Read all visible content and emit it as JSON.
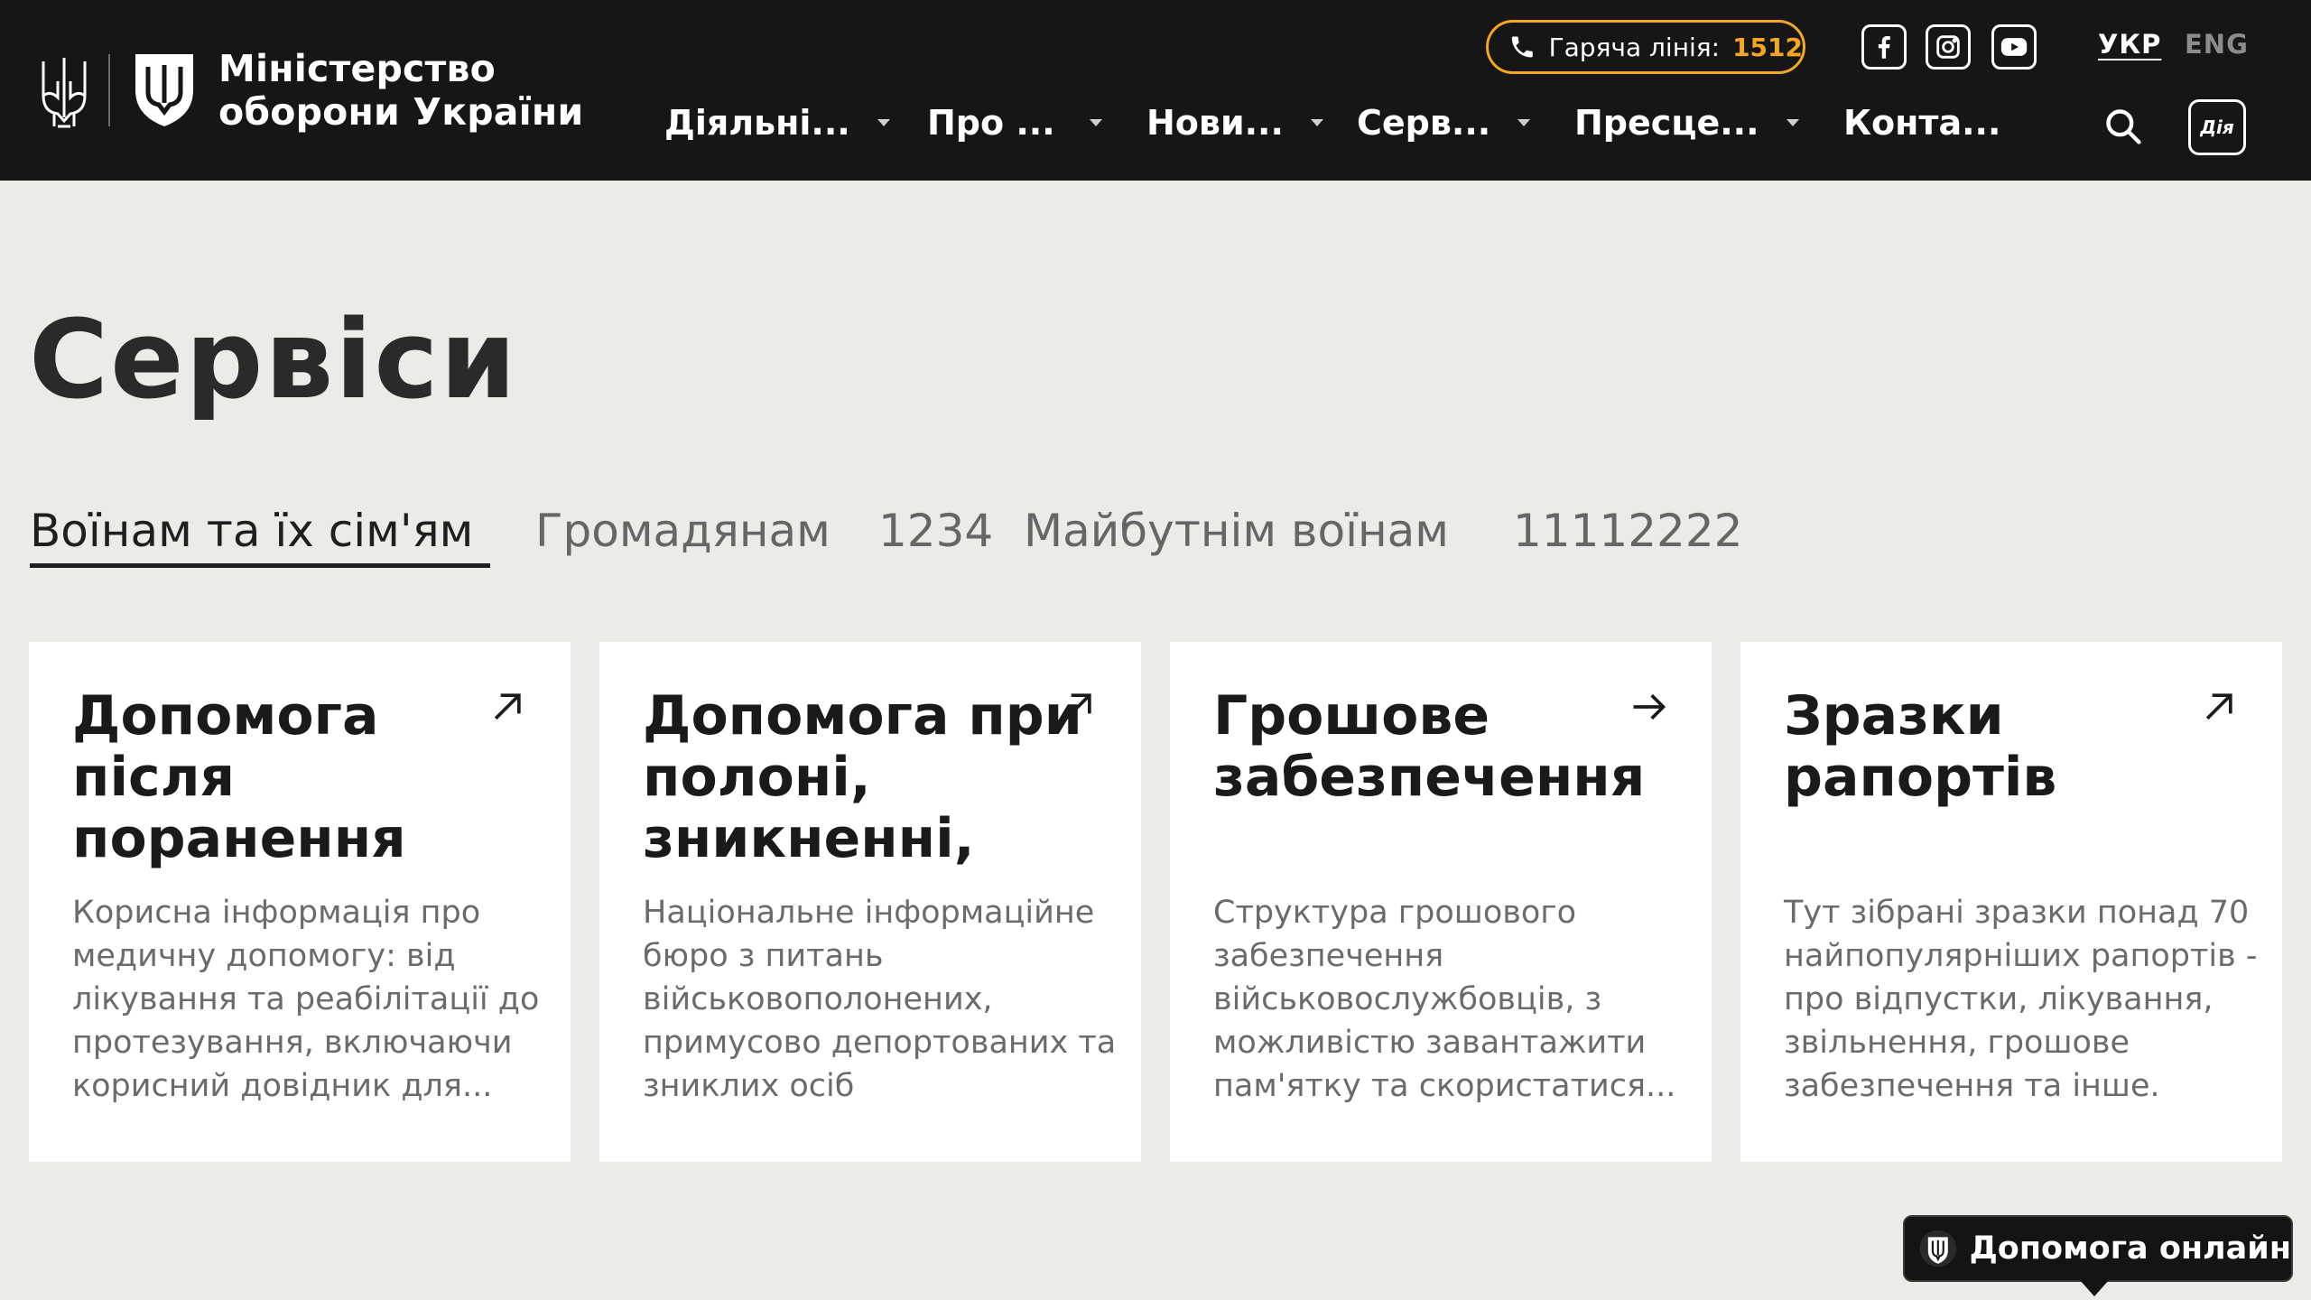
{
  "brand": {
    "line1": "Міністерство",
    "line2": "оборони України"
  },
  "hotline": {
    "label": "Гаряча лінія:",
    "number": "1512"
  },
  "social": {
    "facebook": "facebook-icon",
    "instagram": "instagram-icon",
    "youtube": "youtube-icon"
  },
  "languages": {
    "ukr": "УКР",
    "eng": "ENG"
  },
  "nav": {
    "items": [
      {
        "label": "Діяльні..."
      },
      {
        "label": "Про ..."
      },
      {
        "label": "Нови..."
      },
      {
        "label": "Серв..."
      },
      {
        "label": "Пресце..."
      },
      {
        "label": "Конта..."
      }
    ]
  },
  "diia": {
    "label": "Дія"
  },
  "page": {
    "title": "Сервіси"
  },
  "tabs": [
    {
      "label": "Воїнам та їх сім'ям",
      "active": true
    },
    {
      "label": "Громадянам",
      "active": false
    },
    {
      "label": "1234",
      "active": false
    },
    {
      "label": "Майбутнім воїнам",
      "active": false
    },
    {
      "label": "11112222",
      "active": false
    }
  ],
  "cards": [
    {
      "title": "Допомога після поранення",
      "description": "Корисна інформація про медичну допомогу: від лікування та реабілітації до протезування, включаючи корисний довідник для...",
      "arrow": "arrow-up-right-icon"
    },
    {
      "title": "Допомога при полоні, зникненні,",
      "description": "Національне інформаційне бюро з питань військовополонених, примусово депортованих та зниклих осіб",
      "arrow": "arrow-up-right-icon"
    },
    {
      "title": "Грошове забезпечення",
      "description": "Структура грошового забезпечення військовослужбовців, з можливістю завантажити пам'ятку та скористатися...",
      "arrow": "arrow-right-icon"
    },
    {
      "title": "Зразки рапортів",
      "description": "Тут зібрані зразки понад 70 найпопулярніших рапортів - про відпустки, лікування, звільнення, грошове забезпечення та інше.",
      "arrow": "arrow-up-right-icon"
    }
  ],
  "help": {
    "label": "Допомога онлайн"
  },
  "colors": {
    "header_bg": "#161616",
    "page_bg": "#ECEBE7",
    "accent": "#F5A623",
    "card_bg": "#FFFFFF"
  }
}
